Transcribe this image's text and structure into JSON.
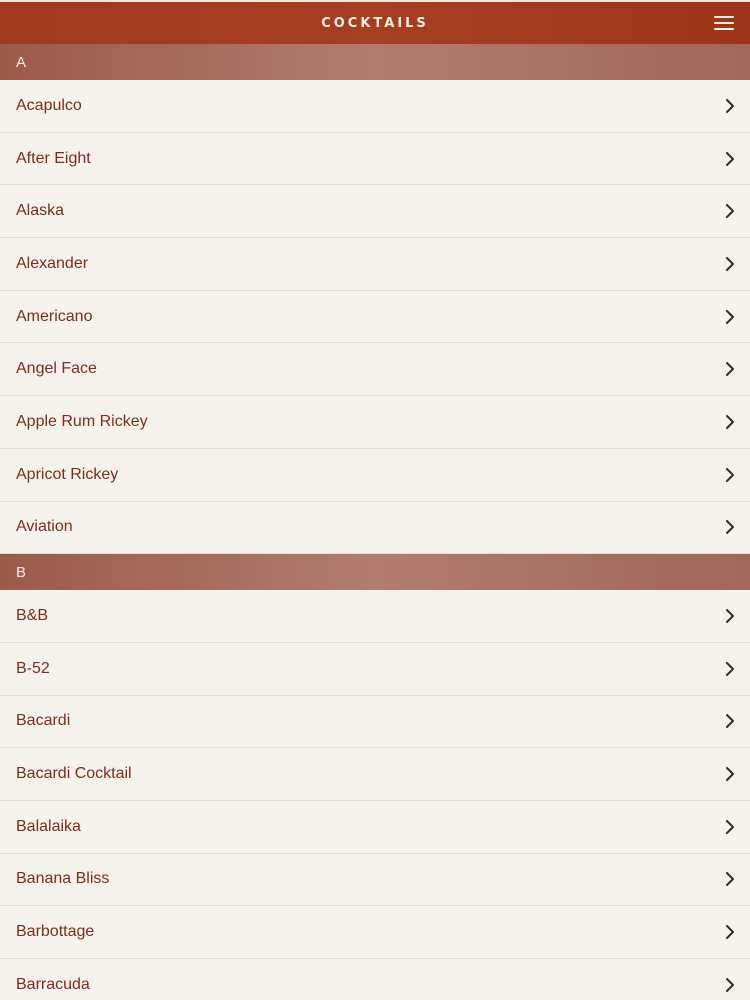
{
  "header": {
    "title": "COCKTAILS",
    "menu_icon": "hamburger-menu-icon"
  },
  "colors": {
    "header": "#a03a1e",
    "section": "#a86d60",
    "text": "#7a2f1c",
    "background": "#f6f1ec"
  },
  "sections": [
    {
      "letter": "A",
      "items": [
        "Acapulco",
        "After Eight",
        "Alaska",
        "Alexander",
        "Americano",
        "Angel Face",
        "Apple Rum Rickey",
        "Apricot Rickey",
        "Aviation"
      ]
    },
    {
      "letter": "B",
      "items": [
        "B&B",
        "B-52",
        "Bacardi",
        "Bacardi Cocktail",
        "Balalaika",
        "Banana Bliss",
        "Barbottage",
        "Barracuda"
      ]
    }
  ]
}
